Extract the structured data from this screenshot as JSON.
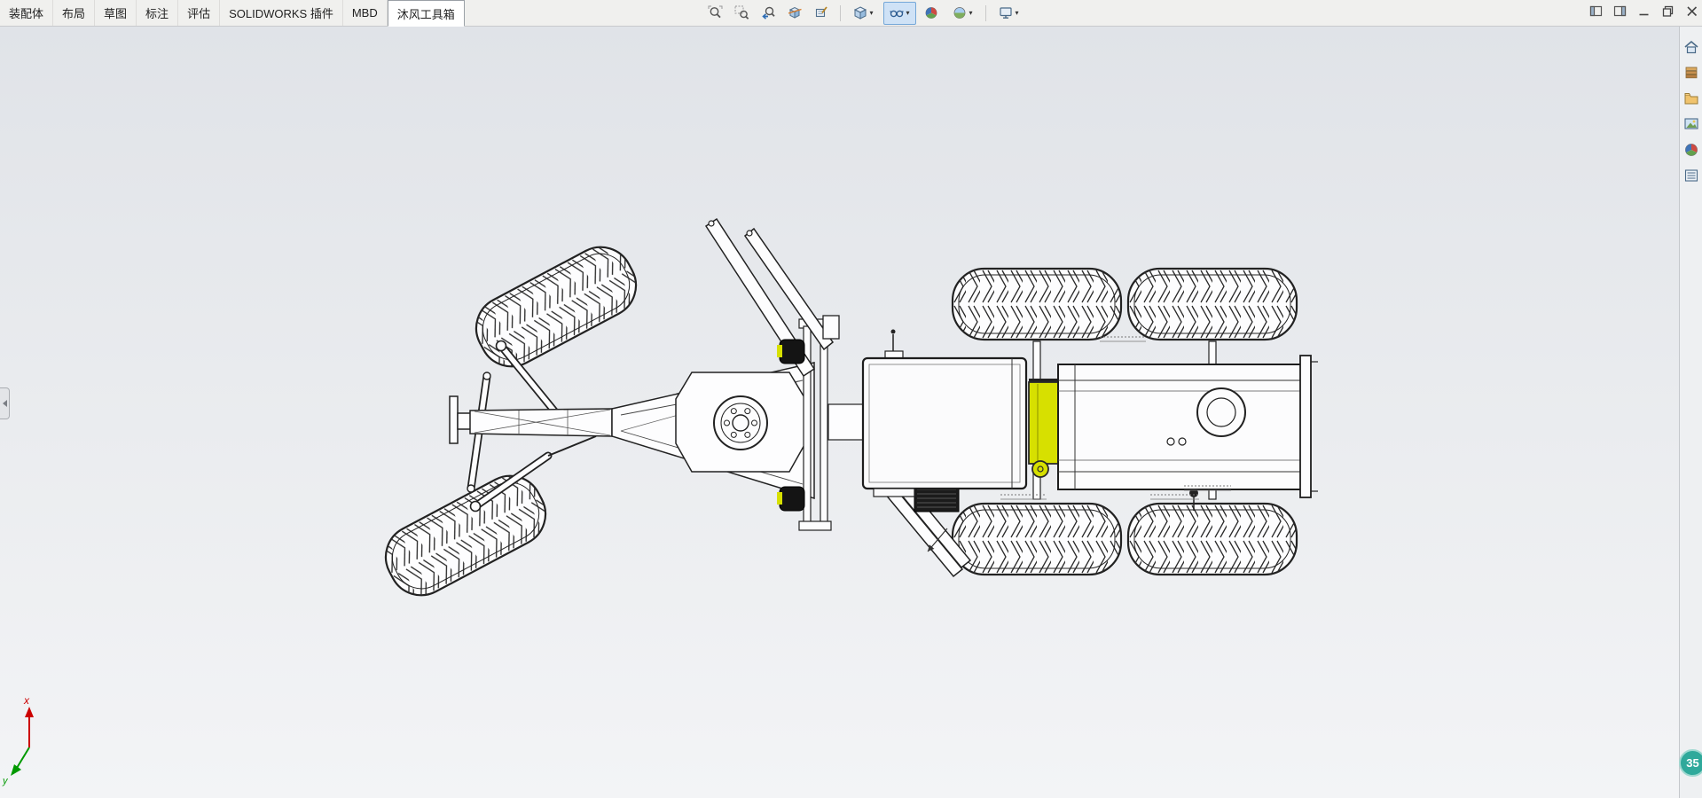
{
  "tabs": [
    {
      "label": "装配体",
      "active": false
    },
    {
      "label": "布局",
      "active": false
    },
    {
      "label": "草图",
      "active": false
    },
    {
      "label": "标注",
      "active": false
    },
    {
      "label": "评估",
      "active": false
    },
    {
      "label": "SOLIDWORKS 插件",
      "active": false
    },
    {
      "label": "MBD",
      "active": false
    },
    {
      "label": "沐风工具箱",
      "active": true
    }
  ],
  "headsup_toolbar": {
    "icons": [
      {
        "name": "zoom-fit",
        "dropdown": false,
        "active": false
      },
      {
        "name": "zoom-area",
        "dropdown": false,
        "active": false
      },
      {
        "name": "previous-view",
        "dropdown": false,
        "active": false
      },
      {
        "name": "section-view",
        "dropdown": false,
        "active": false
      },
      {
        "name": "dynamic-annotation-views",
        "dropdown": false,
        "active": false
      },
      {
        "name": "view-orientation",
        "dropdown": true,
        "active": false
      },
      {
        "name": "hide-show-items",
        "dropdown": true,
        "active": true
      },
      {
        "name": "edit-appearance",
        "dropdown": false,
        "active": false
      },
      {
        "name": "apply-scene",
        "dropdown": true,
        "active": false
      },
      {
        "name": "view-settings",
        "dropdown": true,
        "active": false
      }
    ]
  },
  "window_controls": {
    "buttons": [
      {
        "name": "show-preview-pane"
      },
      {
        "name": "show-display-pane"
      },
      {
        "name": "minimize"
      },
      {
        "name": "restore-down"
      },
      {
        "name": "close"
      }
    ]
  },
  "task_pane": {
    "icons": [
      {
        "name": "solidworks-resources"
      },
      {
        "name": "design-library"
      },
      {
        "name": "file-explorer"
      },
      {
        "name": "view-palette"
      },
      {
        "name": "appearances-scenes"
      },
      {
        "name": "custom-properties"
      }
    ]
  },
  "viewport": {
    "badge_count": "35",
    "triad": {
      "x_label": "x",
      "y_label": "y"
    }
  },
  "ui": {
    "dropdown_glyph": "▾"
  },
  "colors": {
    "accent_yellow": "#d7e000",
    "badge_teal": "#2fa99b",
    "active_highlight": "#cfe2f6",
    "viewport_top": "#e0e3e8",
    "viewport_bottom": "#f3f4f6"
  }
}
